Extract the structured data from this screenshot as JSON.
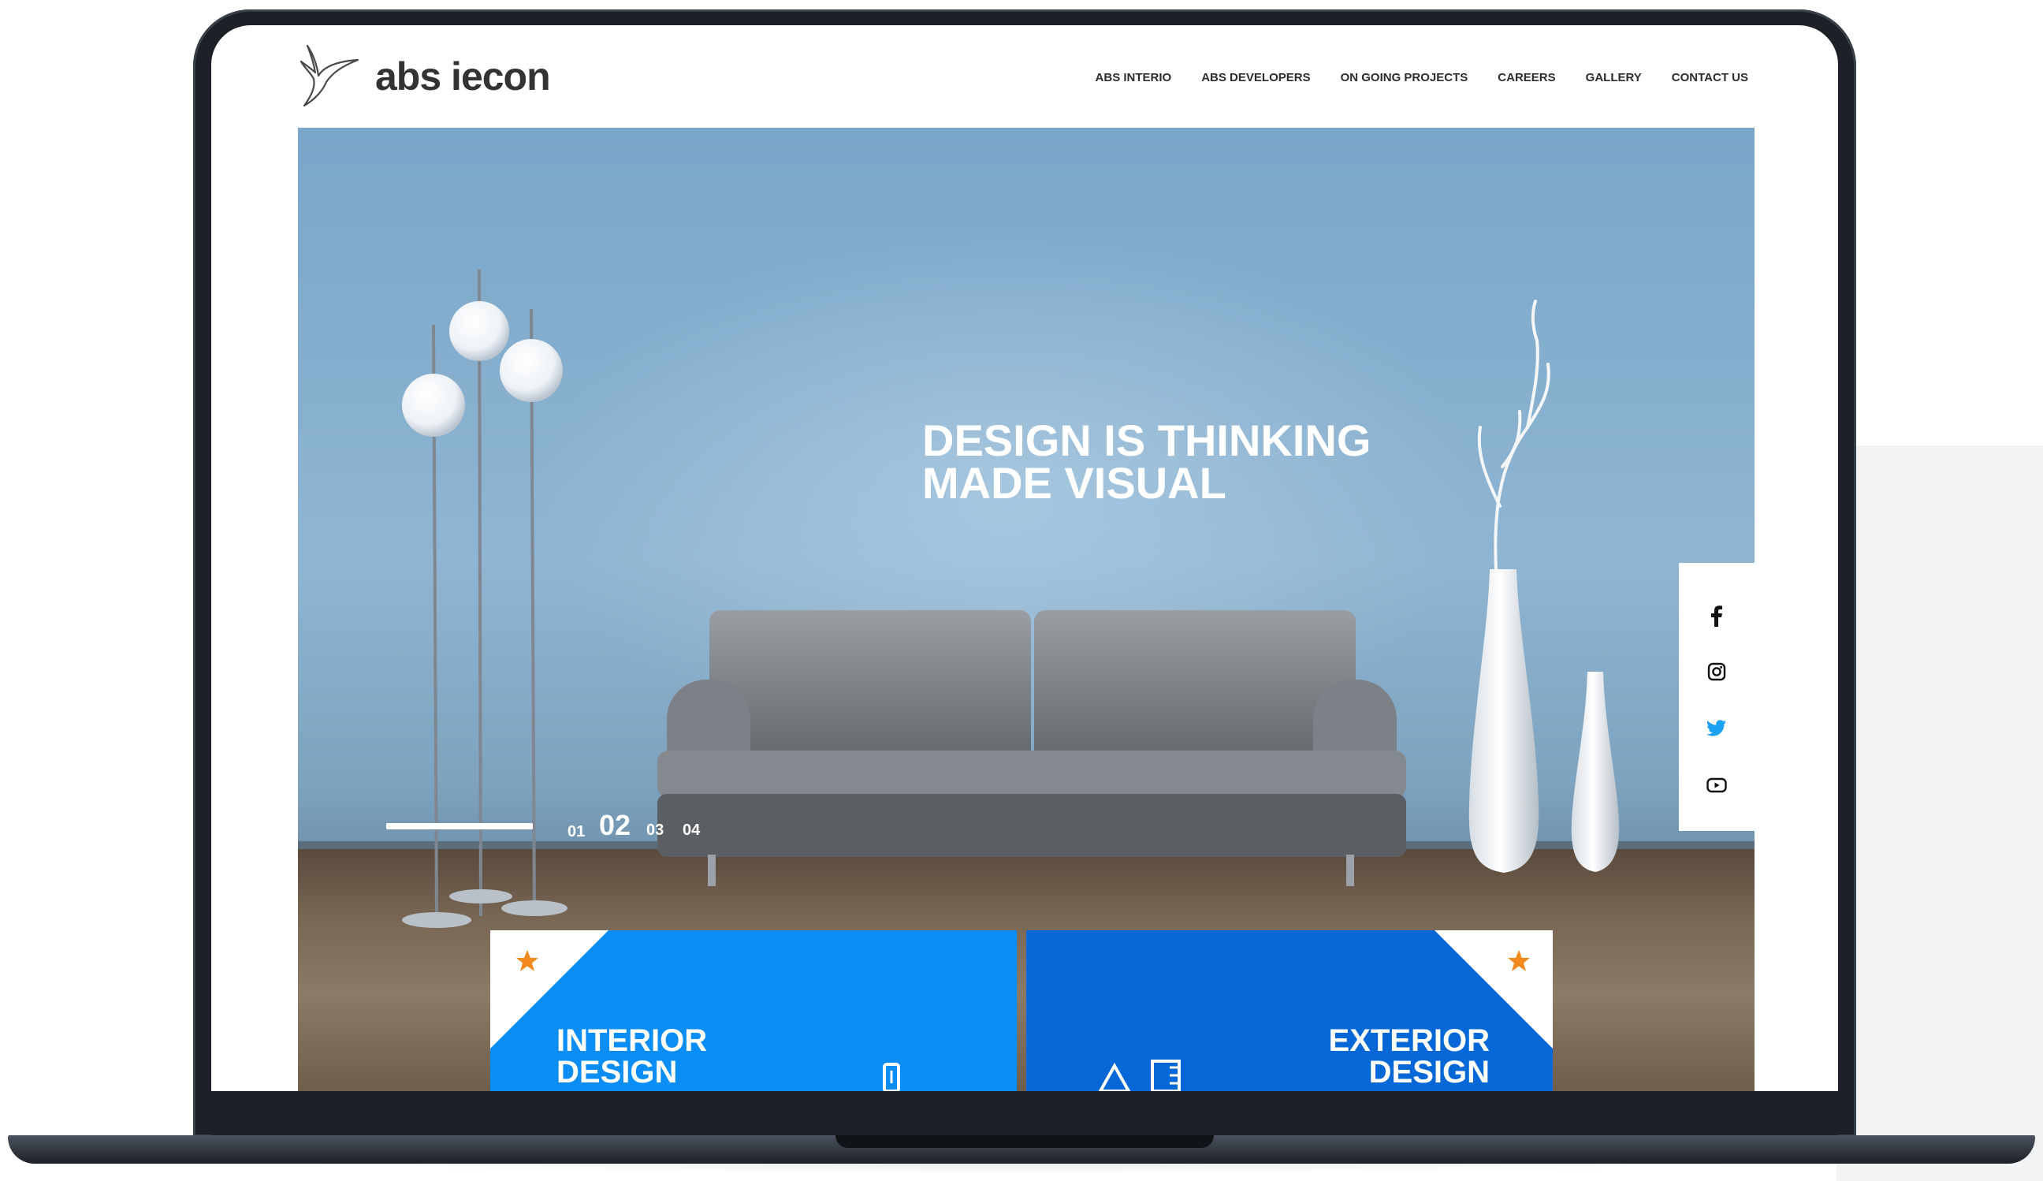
{
  "brand": {
    "name": "abs iecon",
    "logo_icon": "hummingbird-logo-icon"
  },
  "nav": {
    "items": [
      {
        "label": "ABS INTERIO"
      },
      {
        "label": "ABS DEVELOPERS"
      },
      {
        "label": "ON GOING PROJECTS"
      },
      {
        "label": "CAREERS"
      },
      {
        "label": "GALLERY"
      },
      {
        "label": "CONTACT US"
      }
    ]
  },
  "hero": {
    "tagline_line1": "DESIGN IS THINKING",
    "tagline_line2": "MADE VISUAL",
    "slides": [
      "01",
      "02",
      "03",
      "04"
    ],
    "active_slide": "02"
  },
  "social": [
    {
      "icon": "facebook-icon"
    },
    {
      "icon": "instagram-icon"
    },
    {
      "icon": "twitter-icon"
    },
    {
      "icon": "youtube-icon"
    }
  ],
  "cards": {
    "interior": {
      "line1": "INTERIOR",
      "line2": "DESIGN",
      "icon": "lamp-icon",
      "badge_icon": "star-icon"
    },
    "exterior": {
      "line1": "EXTERIOR",
      "line2": "DESIGN",
      "icon": "drafting-tools-icon",
      "badge_icon": "star-icon"
    }
  },
  "colors": {
    "card_interior": "#0a8ef5",
    "card_exterior": "#0568d6",
    "star": "#f28a1e",
    "twitter": "#1da1f2"
  }
}
